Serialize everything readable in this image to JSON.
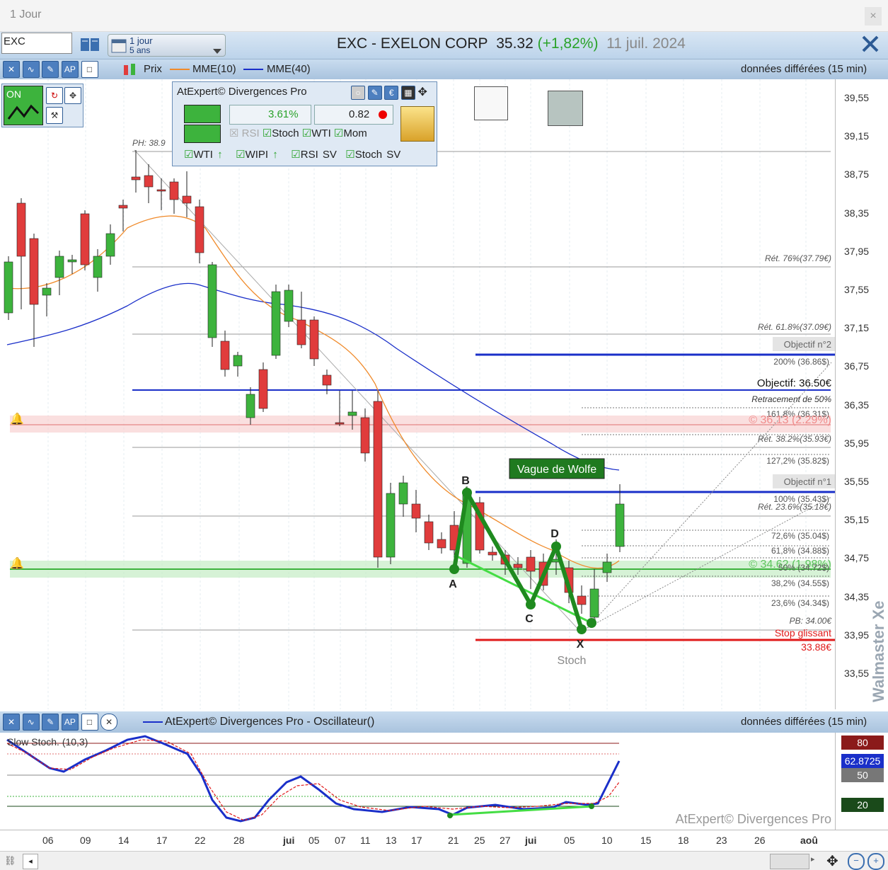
{
  "window": {
    "title": "1 Jour",
    "close": "×"
  },
  "header": {
    "symbol": "EXC",
    "period_top": "1 jour",
    "period_bottom": "5 ans",
    "name": "EXC - EXELON CORP",
    "price": "35.32",
    "change": "(+1,82%)",
    "date": "11 juil. 2024"
  },
  "toolbar": {
    "prix": "Prix",
    "mme10": "MME(10)",
    "mme40": "MME(40)",
    "delay": "données différées (15 min)"
  },
  "divergences_panel": {
    "title": "AtExpert© Divergences Pro",
    "pct": "3.61%",
    "ratio": "0.82",
    "on": "ON",
    "checks1": [
      "RSI",
      "Stoch",
      "WTI",
      "Mom"
    ],
    "checks2": [
      "WTI",
      "WIPI",
      "RSI SV",
      "Stoch SV"
    ]
  },
  "price_axis": [
    "39,55",
    "39,15",
    "38,75",
    "38,35",
    "37,95",
    "37,55",
    "37,15",
    "36,75",
    "36,35",
    "35,95",
    "35,55",
    "35,15",
    "34,75",
    "34,35",
    "33,95",
    "33,55"
  ],
  "annotations": {
    "ph": "PH: 38.9",
    "ret76": "Rét. 76%(37.79€)",
    "ret618": "Rét. 61.8%(37.09€)",
    "obj2": "Objectif n°2",
    "p200": "200% (36.86$)",
    "objectif": "Objectif: 36.50€",
    "retr50": "Retracement de 50%",
    "p1618": "161,8% (36.31$)",
    "alert_red": "© 36.13 (2.29%)",
    "p1414": "Rét. 38.2%(35.93€)",
    "p1272": "127,2% (35.82$)",
    "wolfe": "Vague de Wolfe",
    "obj1": "Objectif n°1",
    "p100": "100% (35.43$)",
    "ret236": "Rét. 23.6%(35.18€)",
    "p726": "72,6% (35.04$)",
    "p618": "61,8% (34.88$)",
    "alert_green": "© 34.62 (1.98%)",
    "p50": "50% (34.72$)",
    "p382": "38,2% (34.55$)",
    "p236": "23,6% (34.34$)",
    "pb": "PB: 34.00€",
    "stop": "Stop glissant",
    "stopval": "33.88€",
    "stoch": "Stoch",
    "A": "A",
    "B": "B",
    "C": "C",
    "D": "D",
    "X": "X",
    "watermark": "Walmaster Xe"
  },
  "oscillator": {
    "title": "AtExpert© Divergences Pro - Oscillateur()",
    "delay": "données différées (15 min)",
    "label": "Slow Stoch. (10,3)",
    "levels": [
      "80",
      "62.8725",
      "50",
      "20"
    ],
    "brand": "AtExpert© Divergences Pro"
  },
  "dates": [
    "06",
    "09",
    "14",
    "17",
    "22",
    "28",
    "jui",
    "05",
    "07",
    "11",
    "13",
    "17",
    "21",
    "25",
    "27",
    "jui",
    "05",
    "10",
    "15",
    "18",
    "23",
    "26",
    "aoû"
  ],
  "colors": {
    "up": "#3db33d",
    "down": "#e03c3c",
    "blue": "#1a2fc9",
    "orange": "#f08a2a"
  }
}
